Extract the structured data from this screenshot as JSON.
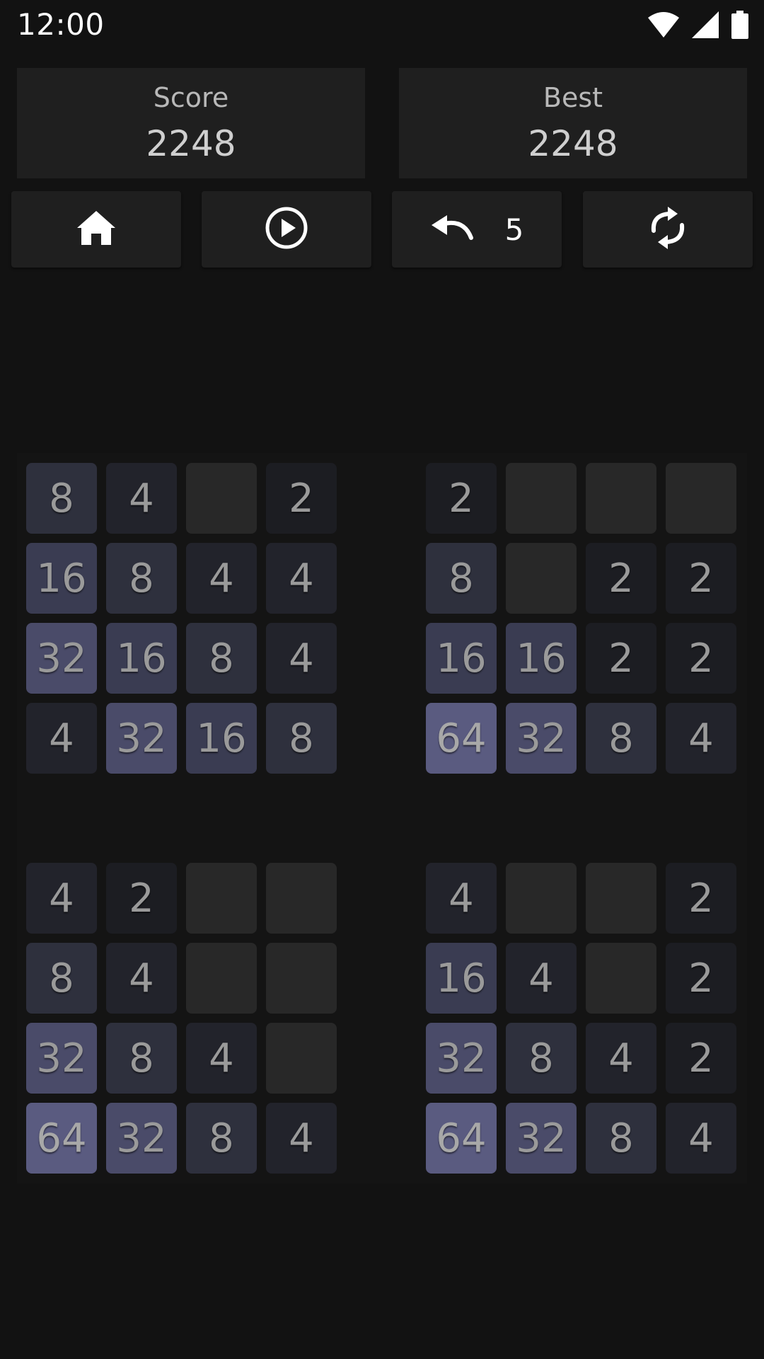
{
  "status_bar": {
    "time": "12:00",
    "icons": [
      "wifi-icon",
      "signal-icon",
      "battery-icon"
    ]
  },
  "score": {
    "label": "Score",
    "value": "2248"
  },
  "best": {
    "label": "Best",
    "value": "2248"
  },
  "controls": {
    "home_icon": "home-icon",
    "play_icon": "play-circle-icon",
    "undo_icon": "undo-icon",
    "undo_count": "5",
    "restart_icon": "refresh-icon"
  },
  "boards": [
    [
      [
        8,
        4,
        0,
        2
      ],
      [
        16,
        8,
        4,
        4
      ],
      [
        32,
        16,
        8,
        4
      ],
      [
        4,
        32,
        16,
        8
      ]
    ],
    [
      [
        2,
        0,
        0,
        0
      ],
      [
        8,
        0,
        2,
        2
      ],
      [
        16,
        16,
        2,
        2
      ],
      [
        64,
        32,
        8,
        4
      ]
    ],
    [
      [
        4,
        2,
        0,
        0
      ],
      [
        8,
        4,
        0,
        0
      ],
      [
        32,
        8,
        4,
        0
      ],
      [
        64,
        32,
        8,
        4
      ]
    ],
    [
      [
        4,
        0,
        0,
        2
      ],
      [
        16,
        4,
        0,
        2
      ],
      [
        32,
        8,
        4,
        2
      ],
      [
        64,
        32,
        8,
        4
      ]
    ]
  ],
  "colors": {
    "background": "#121212",
    "panel": "#1f1f1f",
    "empty_tile": "#282828",
    "tile_2": "#1c1d22",
    "tile_4": "#22232b",
    "tile_8": "#2e303d",
    "tile_16": "#3a3c52",
    "tile_32": "#4a4b69",
    "tile_64": "#5a5b80"
  }
}
